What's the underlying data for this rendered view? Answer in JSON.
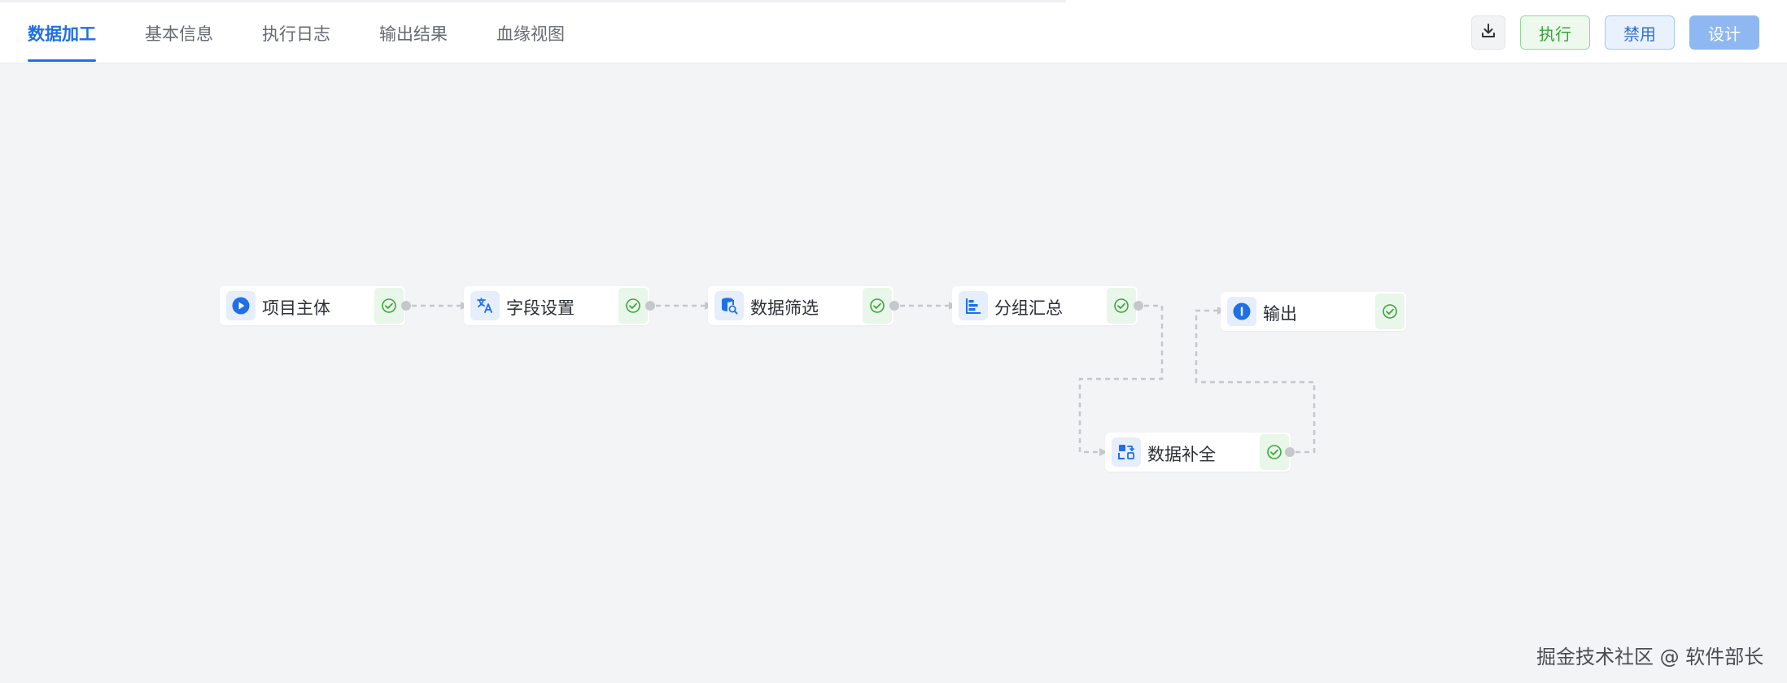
{
  "tabs": [
    {
      "label": "数据加工",
      "active": true
    },
    {
      "label": "基本信息",
      "active": false
    },
    {
      "label": "执行日志",
      "active": false
    },
    {
      "label": "输出结果",
      "active": false
    },
    {
      "label": "血缘视图",
      "active": false
    }
  ],
  "toolbar": {
    "download_icon": "download-icon",
    "run_label": "执行",
    "disable_label": "禁用",
    "design_label": "设计"
  },
  "nodes": [
    {
      "id": "project",
      "label": "项目主体",
      "icon": "play-icon",
      "status": "success"
    },
    {
      "id": "fields",
      "label": "字段设置",
      "icon": "translate-icon",
      "status": "success"
    },
    {
      "id": "filter",
      "label": "数据筛选",
      "icon": "database-search-icon",
      "status": "success"
    },
    {
      "id": "group",
      "label": "分组汇总",
      "icon": "group-bars-icon",
      "status": "success"
    },
    {
      "id": "complete",
      "label": "数据补全",
      "icon": "data-complete-icon",
      "status": "success"
    },
    {
      "id": "output",
      "label": "输出",
      "icon": "info-icon",
      "status": "success"
    }
  ],
  "edges": [
    {
      "from": "project",
      "to": "fields"
    },
    {
      "from": "fields",
      "to": "filter"
    },
    {
      "from": "filter",
      "to": "group"
    },
    {
      "from": "group",
      "to": "complete"
    },
    {
      "from": "complete",
      "to": "output"
    }
  ],
  "colors": {
    "accent": "#1f6fe5",
    "success": "#3aa63a",
    "edge": "#c4c7cc",
    "canvas_bg": "#f3f4f6"
  },
  "watermark": "掘金技术社区 @ 软件部长"
}
